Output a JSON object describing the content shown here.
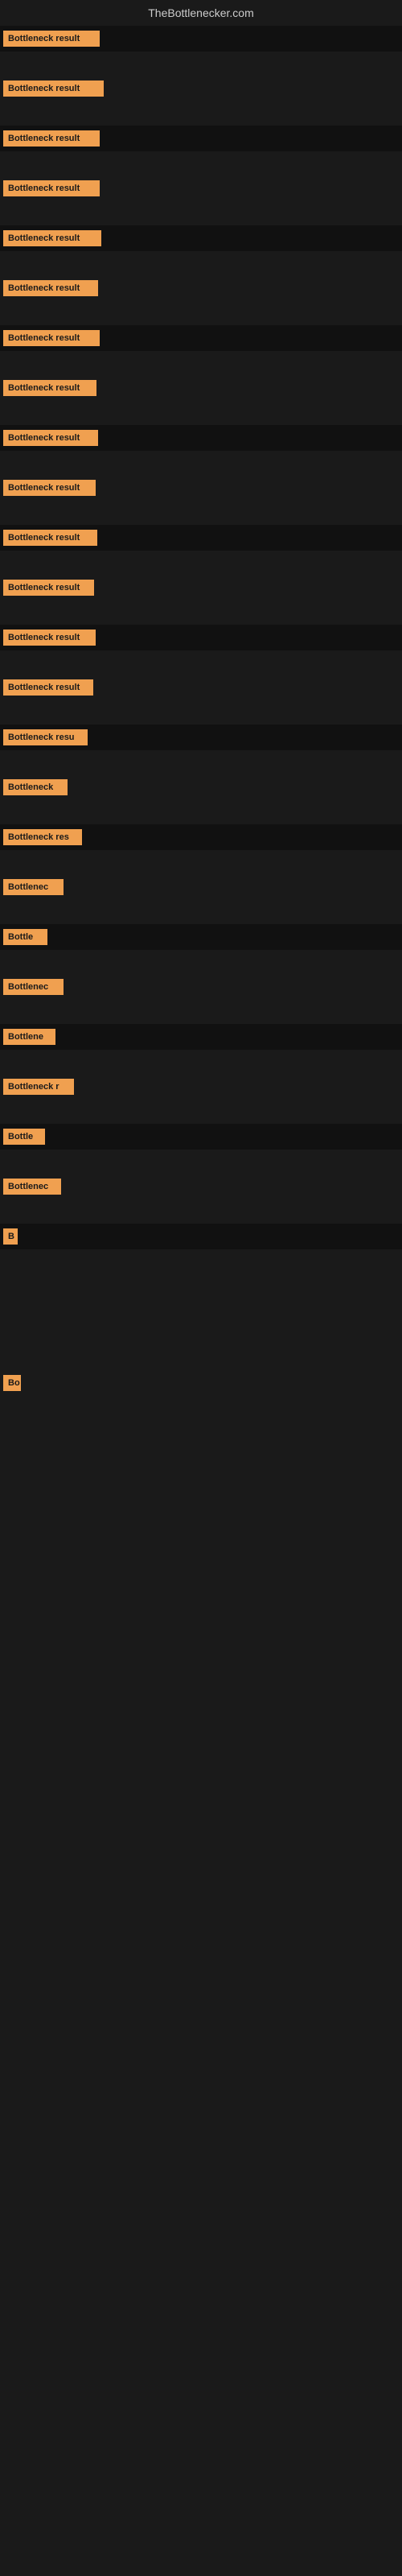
{
  "site": {
    "title": "TheBottlenecker.com"
  },
  "rows": [
    {
      "label": "Bottleneck result",
      "width": 120,
      "bg": "dark",
      "spacer": 30
    },
    {
      "label": "Bottleneck result",
      "width": 125,
      "bg": "medium",
      "spacer": 30
    },
    {
      "label": "Bottleneck result",
      "width": 120,
      "bg": "dark",
      "spacer": 30
    },
    {
      "label": "Bottleneck result",
      "width": 120,
      "bg": "medium",
      "spacer": 30
    },
    {
      "label": "Bottleneck result",
      "width": 122,
      "bg": "dark",
      "spacer": 30
    },
    {
      "label": "Bottleneck result",
      "width": 118,
      "bg": "medium",
      "spacer": 30
    },
    {
      "label": "Bottleneck result",
      "width": 120,
      "bg": "dark",
      "spacer": 30
    },
    {
      "label": "Bottleneck result",
      "width": 116,
      "bg": "medium",
      "spacer": 30
    },
    {
      "label": "Bottleneck result",
      "width": 118,
      "bg": "dark",
      "spacer": 30
    },
    {
      "label": "Bottleneck result",
      "width": 115,
      "bg": "medium",
      "spacer": 30
    },
    {
      "label": "Bottleneck result",
      "width": 117,
      "bg": "dark",
      "spacer": 30
    },
    {
      "label": "Bottleneck result",
      "width": 113,
      "bg": "medium",
      "spacer": 30
    },
    {
      "label": "Bottleneck result",
      "width": 115,
      "bg": "dark",
      "spacer": 30
    },
    {
      "label": "Bottleneck result",
      "width": 112,
      "bg": "medium",
      "spacer": 30
    },
    {
      "label": "Bottleneck resu",
      "width": 105,
      "bg": "dark",
      "spacer": 30
    },
    {
      "label": "Bottleneck",
      "width": 80,
      "bg": "medium",
      "spacer": 30
    },
    {
      "label": "Bottleneck res",
      "width": 98,
      "bg": "dark",
      "spacer": 30
    },
    {
      "label": "Bottlenec",
      "width": 75,
      "bg": "medium",
      "spacer": 30
    },
    {
      "label": "Bottle",
      "width": 55,
      "bg": "dark",
      "spacer": 30
    },
    {
      "label": "Bottlenec",
      "width": 75,
      "bg": "medium",
      "spacer": 30
    },
    {
      "label": "Bottlene",
      "width": 65,
      "bg": "dark",
      "spacer": 30
    },
    {
      "label": "Bottleneck r",
      "width": 88,
      "bg": "medium",
      "spacer": 30
    },
    {
      "label": "Bottle",
      "width": 52,
      "bg": "dark",
      "spacer": 30
    },
    {
      "label": "Bottlenec",
      "width": 72,
      "bg": "medium",
      "spacer": 30
    },
    {
      "label": "B",
      "width": 18,
      "bg": "dark",
      "spacer": 150
    },
    {
      "label": "Bo",
      "width": 22,
      "bg": "medium",
      "spacer": 300
    }
  ]
}
